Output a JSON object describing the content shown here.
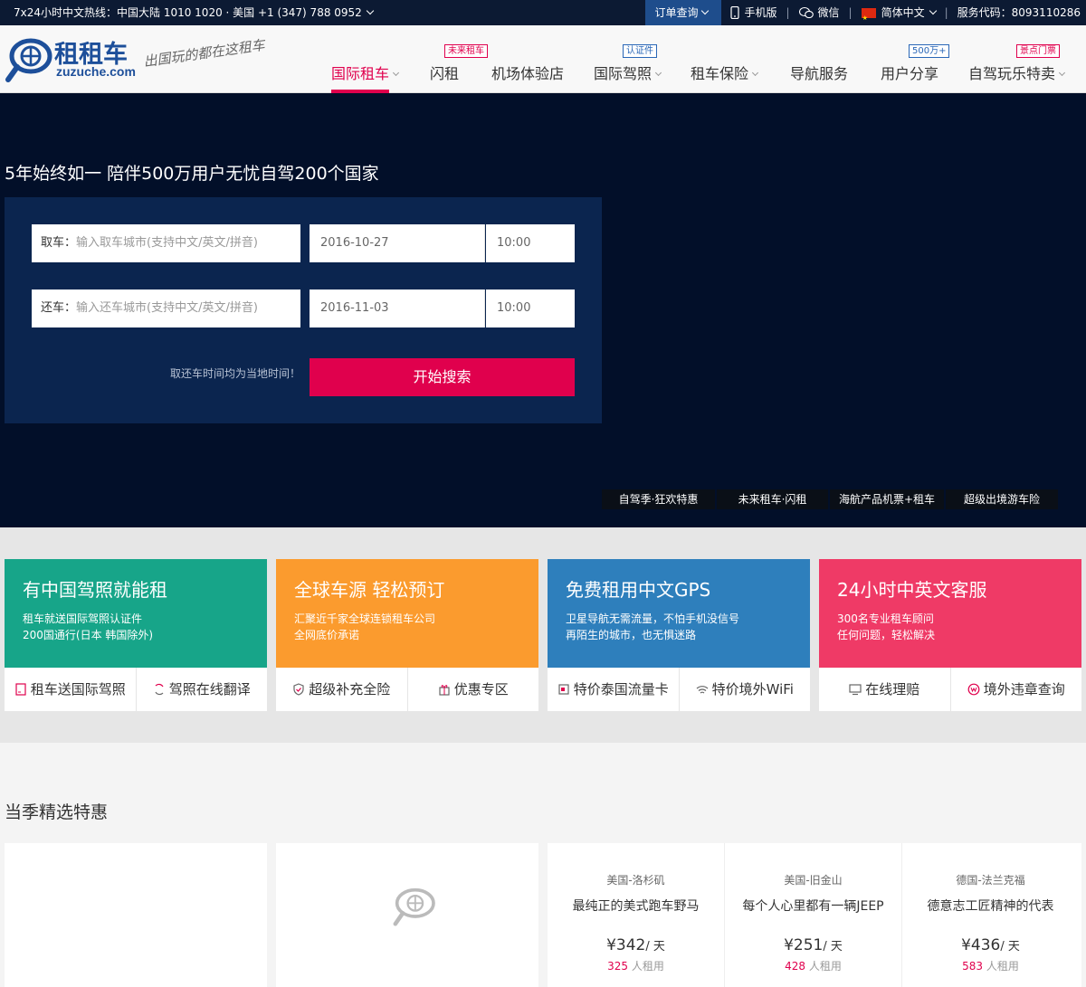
{
  "topbar": {
    "hotline": "7x24小时中文热线：中国大陆 1010 1020 · 美国 +1 (347) 788 0952",
    "order_query": "订单查询",
    "mobile": "手机版",
    "wechat": "微信",
    "language": "简体中文",
    "service_code": "服务代码：8093110286"
  },
  "logo": {
    "name": "租租车",
    "domain": "zuzuche.com",
    "slogan": "出国玩的都在这租车"
  },
  "nav": {
    "items": [
      {
        "label": "国际租车",
        "dropdown": true,
        "active": true
      },
      {
        "label": "闪租",
        "tag": "未来租车"
      },
      {
        "label": "机场体验店"
      },
      {
        "label": "国际驾照",
        "dropdown": true,
        "tag": "认证件"
      },
      {
        "label": "租车保险",
        "dropdown": true
      },
      {
        "label": "导航服务"
      },
      {
        "label": "用户分享",
        "tag": "500万+"
      },
      {
        "label": "自驾玩乐特卖",
        "dropdown": true,
        "tag": "景点门票"
      }
    ]
  },
  "hero": {
    "slogan": "5年始终如一 陪伴500万用户无忧自驾200个国家",
    "pickup_label": "取车：",
    "pickup_placeholder": "输入取车城市(支持中文/英文/拼音)",
    "pickup_date": "2016-10-27",
    "pickup_time": "10:00",
    "return_label": "还车：",
    "return_placeholder": "输入还车城市(支持中文/英文/拼音)",
    "return_date": "2016-11-03",
    "return_time": "10:00",
    "note": "取还车时间均为当地时间！",
    "search_button": "开始搜索",
    "promo_links": [
      "自驾季·狂欢特惠",
      "未来租车·闪租",
      "海航产品机票+租车",
      "超级出境游车险"
    ]
  },
  "features": [
    {
      "title": "有中国驾照就能租",
      "desc": [
        "租车就送国际驾照认证件",
        "200国通行(日本 韩国除外)"
      ],
      "color": "#17a589",
      "links": [
        {
          "label": "租车送国际驾照",
          "icon": "license-icon"
        },
        {
          "label": "驾照在线翻译",
          "icon": "translate-icon"
        }
      ]
    },
    {
      "title": "全球车源 轻松预订",
      "desc": [
        "汇聚近千家全球连锁租车公司",
        "全网底价承诺"
      ],
      "color": "#fb9b2e",
      "links": [
        {
          "label": "超级补充全险",
          "icon": "shield-icon"
        },
        {
          "label": "优惠专区",
          "icon": "gift-icon"
        }
      ]
    },
    {
      "title": "免费租用中文GPS",
      "desc": [
        "卫星导航无需流量，不怕手机没信号",
        "再陌生的城市，也无惧迷路"
      ],
      "color": "#2e7fbc",
      "links": [
        {
          "label": "特价泰国流量卡",
          "icon": "sim-card-icon"
        },
        {
          "label": "特价境外WiFi",
          "icon": "wifi-icon"
        }
      ]
    },
    {
      "title": "24小时中英文客服",
      "desc": [
        "300名专业租车顾问",
        "任何问题，轻松解决"
      ],
      "color": "#ef3a66",
      "links": [
        {
          "label": "在线理赔",
          "icon": "monitor-icon"
        },
        {
          "label": "境外违章查询",
          "icon": "violation-icon"
        }
      ]
    }
  ],
  "season": {
    "title": "当季精选特惠",
    "deals": [
      {
        "location": "美国-洛杉矶",
        "title": "最纯正的美式跑车野马",
        "price": "¥342",
        "unit": "/ 天",
        "count": "325",
        "count_suffix": " 人租用"
      },
      {
        "location": "美国-旧金山",
        "title": "每个人心里都有一辆JEEP",
        "price": "¥251",
        "unit": "/ 天",
        "count": "428",
        "count_suffix": " 人租用"
      },
      {
        "location": "德国-法兰克福",
        "title": "德意志工匠精神的代表",
        "price": "¥436",
        "unit": "/ 天",
        "count": "583",
        "count_suffix": " 人租用"
      }
    ]
  }
}
